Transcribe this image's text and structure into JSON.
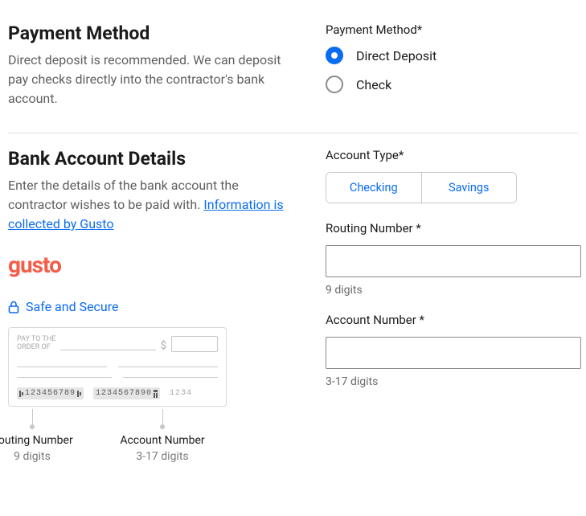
{
  "payment_method": {
    "title": "Payment Method",
    "description": "Direct deposit is recommended. We can deposit pay checks directly into the contractor's bank account.",
    "field_label": "Payment Method*",
    "options": {
      "direct_deposit": "Direct Deposit",
      "check": "Check"
    },
    "selected": "direct_deposit"
  },
  "bank_details": {
    "title": "Bank Account Details",
    "description_pre": "Enter the details of the bank account the contractor wishes to be paid with. ",
    "description_link": "Information is collected by Gusto",
    "logo_text": "gusto",
    "safe_secure": "Safe and Secure",
    "account_type": {
      "label": "Account Type*",
      "options": {
        "checking": "Checking",
        "savings": "Savings"
      }
    },
    "routing": {
      "label": "Routing Number *",
      "hint": "9 digits",
      "value": ""
    },
    "account": {
      "label": "Account Number *",
      "hint": "3-17 digits",
      "value": ""
    }
  },
  "check_illustration": {
    "pay_to": "PAY TO THE\nORDER OF",
    "dollar": "$",
    "routing_sample": "123456789",
    "account_sample": "1234567890",
    "check_num_sample": "1234",
    "pointer_routing_label": "Routing Number",
    "pointer_routing_sub": "9 digits",
    "pointer_account_label": "Account Number",
    "pointer_account_sub": "3-17 digits"
  }
}
